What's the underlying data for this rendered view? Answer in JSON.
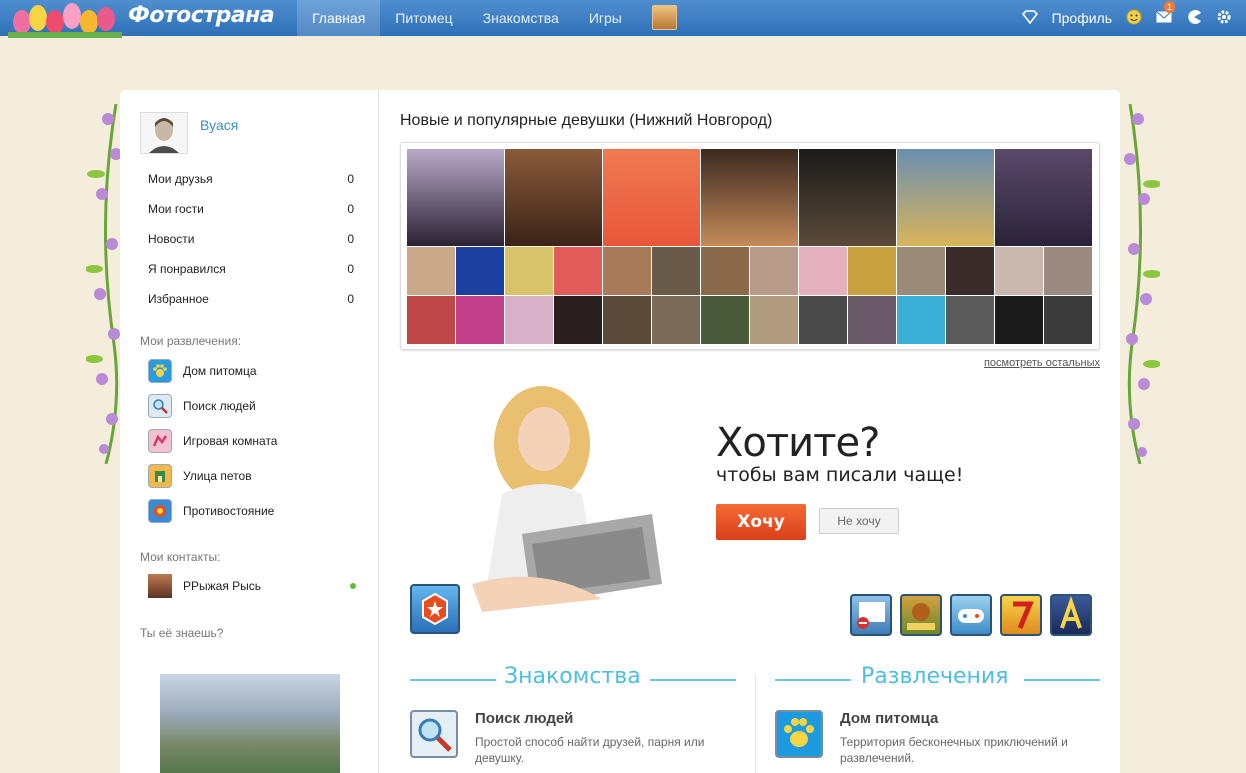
{
  "topbar": {
    "logo": "Фотострана",
    "nav": [
      "Главная",
      "Питомец",
      "Знакомства",
      "Игры"
    ],
    "profile_label": "Профиль",
    "mail_count": "1"
  },
  "sidebar": {
    "user_name": "Вуася",
    "stats": [
      {
        "label": "Мои друзья",
        "count": "0"
      },
      {
        "label": "Мои гости",
        "count": "0"
      },
      {
        "label": "Новости",
        "count": "0"
      },
      {
        "label": "Я понравился",
        "count": "0"
      },
      {
        "label": "Избранное",
        "count": "0"
      }
    ],
    "fun_heading": "Мои развлечения:",
    "fun_items": [
      {
        "label": "Дом питомца",
        "icon": "paw-icon"
      },
      {
        "label": "Поиск людей",
        "icon": "magnifier-icon"
      },
      {
        "label": "Игровая комната",
        "icon": "game-room-icon"
      },
      {
        "label": "Улица петов",
        "icon": "pet-street-icon"
      },
      {
        "label": "Противостояние",
        "icon": "confrontation-icon"
      }
    ],
    "contacts_heading": "Мои контакты:",
    "contact_name": "РРыжая Рысь",
    "know_heading": "Ты её знаешь?"
  },
  "content": {
    "title": "Новые и популярные девушки (Нижний Новгород)",
    "see_more": "посмотреть остальных",
    "promo_heading": "Хотите?",
    "promo_sub": "чтобы вам писали чаще!",
    "btn_want": "Хочу",
    "btn_no": "Не хочу",
    "sections": {
      "dating": "Знакомства",
      "fun": "Развлечения"
    },
    "features": [
      {
        "title": "Поиск людей",
        "desc": "Простой способ найти друзей, парня или девушку."
      },
      {
        "title": "Дом питомца",
        "desc": "Территория бесконечных приключений и развлечений."
      }
    ]
  },
  "colors": {
    "topbar": "#2f6fb6",
    "accent_blue": "#4dbde0",
    "cta_orange": "#e84d22",
    "link_blue": "#3c8fc3",
    "online_green": "#5cc22e"
  }
}
